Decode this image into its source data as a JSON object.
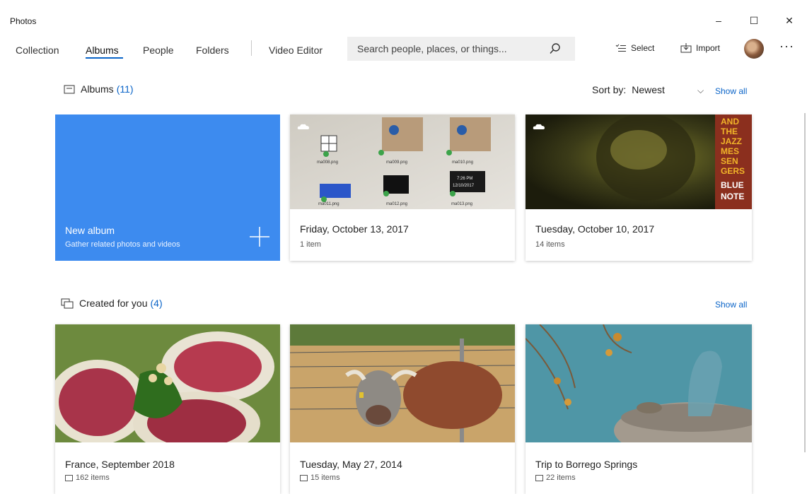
{
  "app": {
    "title": "Photos"
  },
  "window": {
    "minimize": "–",
    "maximize": "☐",
    "close": "✕"
  },
  "nav": {
    "items": [
      {
        "label": "Collection",
        "active": false
      },
      {
        "label": "Albums",
        "active": true
      },
      {
        "label": "People",
        "active": false
      },
      {
        "label": "Folders",
        "active": false
      }
    ],
    "video_editor": "Video Editor"
  },
  "search": {
    "placeholder": "Search people, places, or things..."
  },
  "commands": {
    "select": "Select",
    "import": "Import",
    "more": "···"
  },
  "albums": {
    "heading": "Albums",
    "count": "(11)",
    "sort_label": "Sort by:",
    "sort_value": "Newest",
    "show_all": "Show all",
    "new_album": {
      "title": "New album",
      "subtitle": "Gather related photos and videos"
    },
    "items": [
      {
        "title": "Friday, October 13, 2017",
        "subtitle": "1 item",
        "thumbnail_files": [
          "ma008.png",
          "ma009.png",
          "ma010.png",
          "ma011.png",
          "ma012.png",
          "ma013.png"
        ],
        "thumbnail_time": "7:26 PM",
        "thumbnail_date": "12/10/2017"
      },
      {
        "title": "Tuesday, October 10, 2017",
        "subtitle": "14 items",
        "poster_text": [
          "AND",
          "THE",
          "JAZZ",
          "MES",
          "SEN",
          "GERS",
          "BLUE",
          "NOTE"
        ]
      }
    ]
  },
  "created": {
    "heading": "Created for you",
    "count": "(4)",
    "show_all": "Show all",
    "items": [
      {
        "title": "France, September 2018",
        "subtitle": "162 items"
      },
      {
        "title": "Tuesday, May 27, 2014",
        "subtitle": "15 items"
      },
      {
        "title": "Trip to Borrego Springs",
        "subtitle": "22 items"
      }
    ]
  },
  "icons": {
    "search": "search-icon",
    "select": "select-list-icon",
    "import": "import-icon",
    "album": "album-icon",
    "created": "created-for-you-icon",
    "cloud": "cloud-icon",
    "plus": "plus-icon"
  },
  "colors": {
    "accent": "#0a64c8",
    "new_album_bg": "#3d8bef"
  }
}
